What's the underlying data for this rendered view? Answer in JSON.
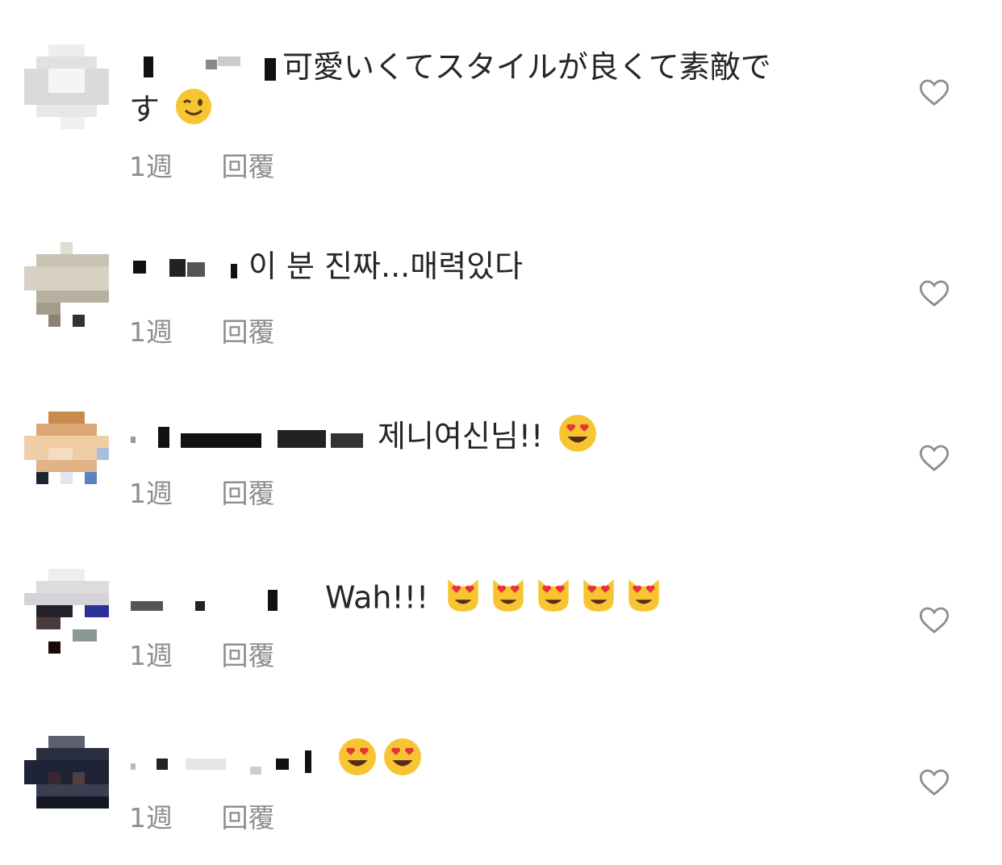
{
  "comments": [
    {
      "avatar_colors": [
        "#e6e6e6",
        "#d9d9d9",
        "#eeeeee",
        "#f2f2f2",
        "#ededed",
        "#dcdcdc",
        "#e4e4e4"
      ],
      "text": "可愛いくてスタイルが良くて素敵で",
      "text_line2": "す",
      "emoji_icon": "winking-face-emoji",
      "time": "1週",
      "reply": "回覆"
    },
    {
      "avatar_colors": [
        "#c9c2b2",
        "#d6d2c4",
        "#bcb5a3",
        "#8a8376",
        "#5a5045",
        "#e2ded3",
        "#a39c8c"
      ],
      "text": "이 분 진짜...매력있다",
      "time": "1週",
      "reply": "回覆"
    },
    {
      "avatar_colors": [
        "#c98a4b",
        "#e0b07a",
        "#f0d3b0",
        "#d4a06a",
        "#8fa8c8",
        "#5b7fb3",
        "#222a33"
      ],
      "text": "제니여신님!!",
      "emoji_icon": "heart-eyes-emoji",
      "time": "1週",
      "reply": "回覆"
    },
    {
      "avatar_colors": [
        "#eeeeee",
        "#2b2b3a",
        "#3b3ba8",
        "#b0b0b0",
        "#8a8a8a",
        "#1a1a1a",
        "#d0d0d8"
      ],
      "text": "Wah!!!",
      "emoji_icon": "heart-eyes-cat-emoji",
      "emoji_count": 5,
      "time": "1週",
      "reply": "回覆"
    },
    {
      "avatar_colors": [
        "#1e2435",
        "#3a3f52",
        "#0e1220",
        "#5c6070",
        "#2a2f40",
        "#141824",
        "#d8d8dc"
      ],
      "text": "",
      "emoji_icon": "heart-eyes-emoji",
      "emoji_count": 2,
      "time": "1週",
      "reply": "回覆"
    }
  ],
  "icons": {
    "like": "heart-outline-icon"
  },
  "colors": {
    "text": "#262626",
    "meta": "#8e8e8e",
    "heart": "#8e8e8e",
    "emoji": "#f5b921"
  }
}
